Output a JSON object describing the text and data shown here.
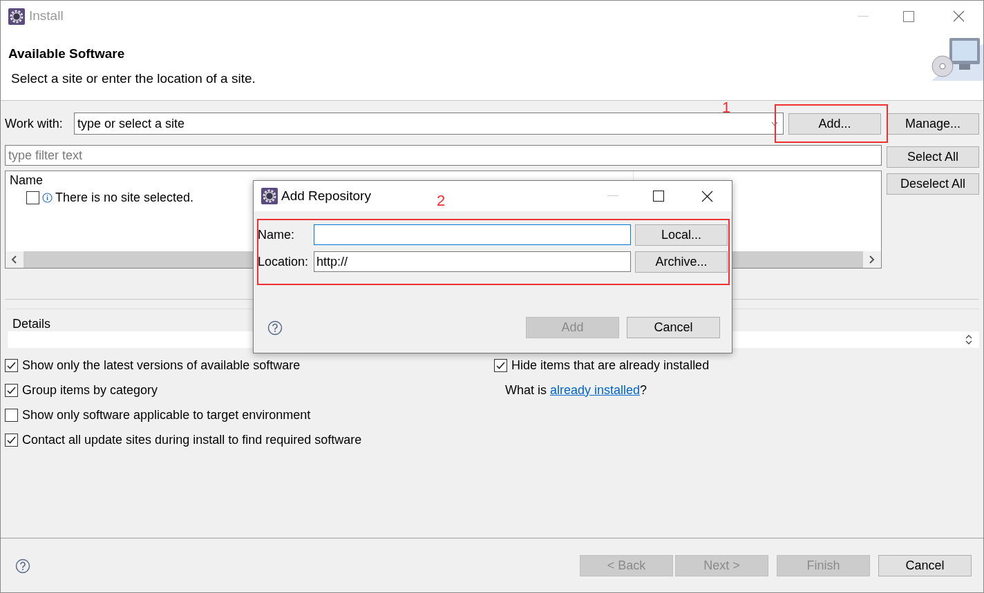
{
  "window": {
    "title": "Install"
  },
  "header": {
    "title": "Available Software",
    "description": "Select a site or enter the location of a site."
  },
  "work_with": {
    "label": "Work with:",
    "placeholder": "type or select a site"
  },
  "side_buttons": [
    "Add...",
    "Manage..."
  ],
  "filter": {
    "placeholder": "type filter text"
  },
  "list_buttons": [
    "Select All",
    "Deselect All"
  ],
  "table": {
    "columns": [
      "Name"
    ],
    "rows": [
      {
        "checked": false,
        "text": "There is no site selected."
      }
    ]
  },
  "details": {
    "label": "Details"
  },
  "options": [
    {
      "label": "Show only the latest versions of available software",
      "checked": true
    },
    {
      "label": "Group items by category",
      "checked": true
    },
    {
      "label": "Show only software applicable to target environment",
      "checked": false
    },
    {
      "label": "Contact all update sites during install to find required software",
      "checked": true
    }
  ],
  "right_options": [
    {
      "label": "Hide items that are already installed",
      "checked": true
    }
  ],
  "installed_note": {
    "before": "What is ",
    "link": "already installed",
    "after": "?"
  },
  "wizard_buttons": [
    {
      "label": "< Back",
      "disabled": true
    },
    {
      "label": "Next >",
      "disabled": true
    },
    {
      "label": "Finish",
      "disabled": true
    },
    {
      "label": "Cancel",
      "disabled": false
    }
  ],
  "dialog": {
    "title": "Add Repository",
    "fields": [
      {
        "label": "Name:",
        "focused": true,
        "button": "Local..."
      },
      {
        "label": "Location:",
        "value": "http://",
        "focused": false,
        "button": "Archive..."
      }
    ],
    "buttons": [
      {
        "label": "Add",
        "disabled": true
      },
      {
        "label": "Cancel",
        "disabled": false
      }
    ]
  },
  "annotations": [
    "1",
    "2"
  ]
}
